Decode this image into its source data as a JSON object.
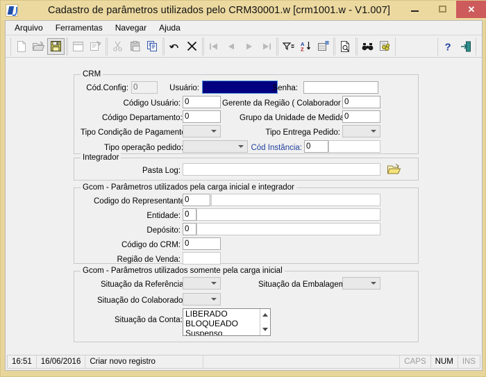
{
  "window": {
    "title": "Cadastro de parâmetros utilizados pelo CRM30001.w [crm1001.w - V1.007]",
    "minimize_label": "",
    "maximize_label": "",
    "close_label": "✕",
    "accent_titlebar": "#ecd9a0",
    "accent_close": "#cd5b5b"
  },
  "menu": {
    "items": [
      {
        "label": "Arquivo"
      },
      {
        "label": "Ferramentas"
      },
      {
        "label": "Navegar"
      },
      {
        "label": "Ajuda"
      }
    ]
  },
  "toolbar": {
    "groups": [
      {
        "buttons": [
          {
            "name": "new-icon",
            "tip": "Novo",
            "state": "disabled"
          },
          {
            "name": "open-folder-icon",
            "tip": "Abrir",
            "state": "disabled"
          },
          {
            "name": "save-disk-icon",
            "tip": "Salvar",
            "state": "pressed"
          }
        ]
      },
      {
        "buttons": [
          {
            "name": "window-icon",
            "tip": "Janela",
            "state": "disabled"
          },
          {
            "name": "properties-icon",
            "tip": "Propriedades",
            "state": "disabled"
          }
        ]
      },
      {
        "buttons": [
          {
            "name": "cut-scissors-icon",
            "tip": "Recortar",
            "state": "disabled"
          },
          {
            "name": "paste-clipboard-icon",
            "tip": "Colar",
            "state": "disabled"
          },
          {
            "name": "copy-icon",
            "tip": "Copiar",
            "state": "enabled"
          }
        ]
      },
      {
        "buttons": [
          {
            "name": "undo-arrow-icon",
            "tip": "Desfazer",
            "state": "enabled"
          },
          {
            "name": "cancel-x-icon",
            "tip": "Cancelar",
            "state": "enabled"
          }
        ]
      },
      {
        "buttons": [
          {
            "name": "first-record-icon",
            "tip": "Primeiro",
            "state": "disabled"
          },
          {
            "name": "previous-record-icon",
            "tip": "Anterior",
            "state": "disabled"
          },
          {
            "name": "next-record-icon",
            "tip": "Próximo",
            "state": "disabled"
          },
          {
            "name": "last-record-icon",
            "tip": "Último",
            "state": "disabled"
          }
        ]
      },
      {
        "buttons": [
          {
            "name": "filter-icon",
            "tip": "Filtrar",
            "state": "enabled"
          },
          {
            "name": "sort-az-icon",
            "tip": "Ordenar",
            "state": "enabled"
          },
          {
            "name": "new-window-icon",
            "tip": "Nova janela",
            "state": "enabled"
          }
        ]
      },
      {
        "buttons": [
          {
            "name": "print-preview-icon",
            "tip": "Visualizar impressão",
            "state": "enabled"
          }
        ]
      },
      {
        "buttons": [
          {
            "name": "binoculars-search-icon",
            "tip": "Pesquisar",
            "state": "enabled"
          },
          {
            "name": "advanced-search-icon",
            "tip": "Pesquisa avançada",
            "state": "enabled"
          }
        ]
      },
      {
        "buttons": [
          {
            "name": "help-question-icon",
            "tip": "Ajuda",
            "state": "enabled"
          },
          {
            "name": "exit-door-icon",
            "tip": "Sair",
            "state": "enabled"
          }
        ]
      }
    ]
  },
  "crm_panel": {
    "legend": "CRM",
    "cod_config": {
      "label": "Cód.Config:",
      "value": "0"
    },
    "usuario": {
      "label": "Usuário:",
      "value": ""
    },
    "senha": {
      "label": "Senha:",
      "value": ""
    },
    "codigo_usuario": {
      "label": "Código Usuário:",
      "value": "0"
    },
    "gerente_regiao": {
      "label": "Gerente da Região ( Colaborador ):",
      "value": "0"
    },
    "codigo_departamento": {
      "label": "Código Departamento:",
      "value": "0"
    },
    "grupo_unidade_medida": {
      "label": "Grupo da Unidade de Medida:",
      "value": "0"
    },
    "tipo_condicao_pagamento": {
      "label": "Tipo Condição de Pagamento:",
      "value": ""
    },
    "tipo_entrega_pedido": {
      "label": "Tipo Entrega Pedido:",
      "value": ""
    },
    "tipo_operacao_pedido": {
      "label": "Tipo operação pedido:",
      "value": ""
    },
    "cod_instancia": {
      "label": "Cód Instância:",
      "value": "0",
      "desc": ""
    }
  },
  "integrador_panel": {
    "legend": "Integrador",
    "pasta_log": {
      "label": "Pasta Log:",
      "value": ""
    },
    "browse_icon": "open-folder-icon"
  },
  "gcom_integrador_panel": {
    "legend": "Gcom - Parâmetros utilizados pela carga inicial e integrador",
    "codigo_representante": {
      "label": "Codigo do Representante:",
      "value": "0",
      "desc": ""
    },
    "entidade": {
      "label": "Entidade:",
      "value": "0",
      "desc": ""
    },
    "deposito": {
      "label": "Depósito:",
      "value": "0",
      "desc": ""
    },
    "codigo_crm": {
      "label": "Código do CRM:",
      "value": "0"
    },
    "regiao_venda": {
      "label": "Região de Venda:",
      "value": ""
    }
  },
  "gcom_carga_panel": {
    "legend": "Gcom - Parâmetros utilizados somente pela carga inicial",
    "situacao_referencia": {
      "label": "Situação da Referência:",
      "value": ""
    },
    "situacao_embalagem": {
      "label": "Situação da Embalagem:",
      "value": ""
    },
    "situacao_colaborador": {
      "label": "Situação do Colaborador:",
      "value": ""
    },
    "situacao_conta": {
      "label": "Situação da Conta:",
      "options": [
        "LIBERADO",
        "BLOQUEADO",
        "Suspenso"
      ]
    }
  },
  "statusbar": {
    "time": "16:51",
    "date": "16/06/2016",
    "message": "Criar novo registro",
    "spacer": "",
    "caps": "CAPS",
    "num": "NUM",
    "ins": "INS"
  }
}
